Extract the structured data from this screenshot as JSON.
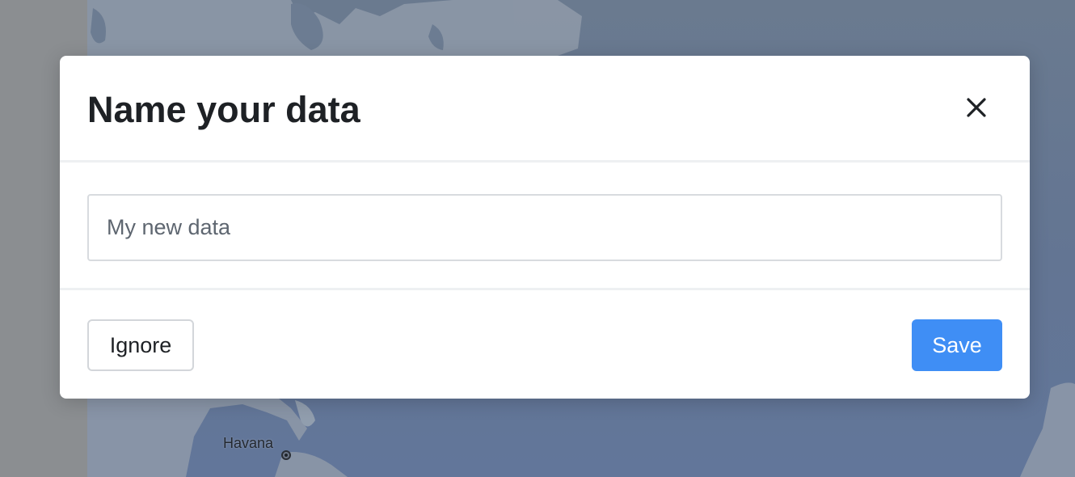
{
  "background": {
    "map_city_label": "Havana"
  },
  "modal": {
    "title": "Name your data",
    "close_icon": "close-icon",
    "input": {
      "value": "",
      "placeholder": "My new data"
    },
    "buttons": {
      "ignore_label": "Ignore",
      "save_label": "Save"
    }
  },
  "colors": {
    "primary": "#3f8ef5",
    "title_text": "#1e2125",
    "divider": "#eef0f2",
    "map_water": "#637593",
    "map_land": "#8e9aaa"
  }
}
